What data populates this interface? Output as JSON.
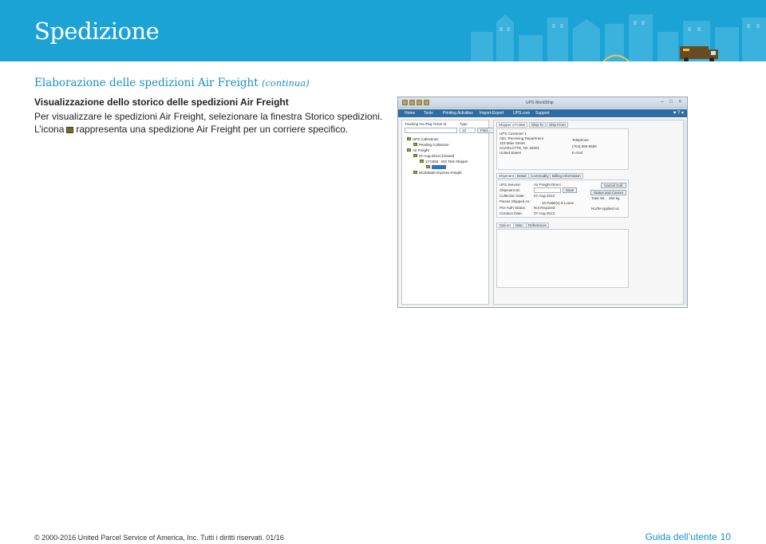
{
  "header": {
    "title": "Spedizione",
    "bg_color": "#1ba3d6"
  },
  "section": {
    "title": "Elaborazione delle spedizioni Air Freight",
    "title_suffix": "(continua)",
    "subtitle": "Visualizzazione dello storico delle spedizioni Air Freight",
    "line1": "Per visualizzare le spedizioni Air Freight, selezionare la finestra Storico spedizioni.",
    "line2_pre": "L’icona",
    "line2_post": "rappresenta una spedizione Air Freight per un corriere specifico.",
    "accent_color": "#1a8fc7"
  },
  "screenshot": {
    "app_title": "UPS WorldShip",
    "window_buttons": "– □ ×",
    "menu": [
      "Home",
      "Tools",
      "Printing Activities",
      "Import-Export",
      "UPS.com",
      "Support"
    ],
    "help": "♥ ? ▾",
    "tracking_label": "Tracking No./Pkg Ticket Id",
    "type_label": "Type",
    "type_value": "1Z",
    "find_button": "Find...",
    "tree": [
      "UPS Collections",
      "Pending Collection",
      "Air Freight",
      "07-Aug-2013 (Closed)",
      "1YC556 : WS Test Shipper",
      "",
      "Worldwide Express Freight"
    ],
    "selected_item_index": 5,
    "tabs_top": [
      "Shipper 1YC556",
      "Ship To",
      "Ship From"
    ],
    "address": [
      "UPS Customer 1",
      "Attn: Receiving Department",
      "123 Main Street",
      "CHARLOTTE, NC 28201",
      "United States"
    ],
    "telephone_label": "Telephone",
    "telephone_value": "(704) 555-5555",
    "email_label": "E-mail",
    "tabs_mid": [
      "Shipment",
      "Detail",
      "Commodity",
      "Billing Information"
    ],
    "detail_fields": [
      {
        "label": "UPS Service:",
        "value": "Air Freight Direct"
      },
      {
        "label": "Shipment ID:",
        "value": ""
      },
      {
        "label": "Collection Date:",
        "value": "07-Aug-2013"
      },
      {
        "label": "Pieces Shipped As:",
        "value": "10 Pallet(s) 6 Loose"
      },
      {
        "label": "Pre-Auth Status:",
        "value": "Not Required"
      },
      {
        "label": "Creation Date:",
        "value": "07-Aug-2013"
      }
    ],
    "save_button": "Save",
    "cancel_collection_button": "Cancel Coll.",
    "status_button": "Status and Cancel",
    "total_wt_label": "Total Wt.:",
    "total_wt_value": "450 kg",
    "hu_label": "HU/W Applied As:",
    "tabs_bottom": [
      "Options",
      "Misc.",
      "References"
    ]
  },
  "footer": {
    "copyright": "© 2000-2016 United Parcel Service of America, Inc. Tutti i diritti riservati. 01/16",
    "guide": "Guida dell’utente",
    "page": "10"
  }
}
